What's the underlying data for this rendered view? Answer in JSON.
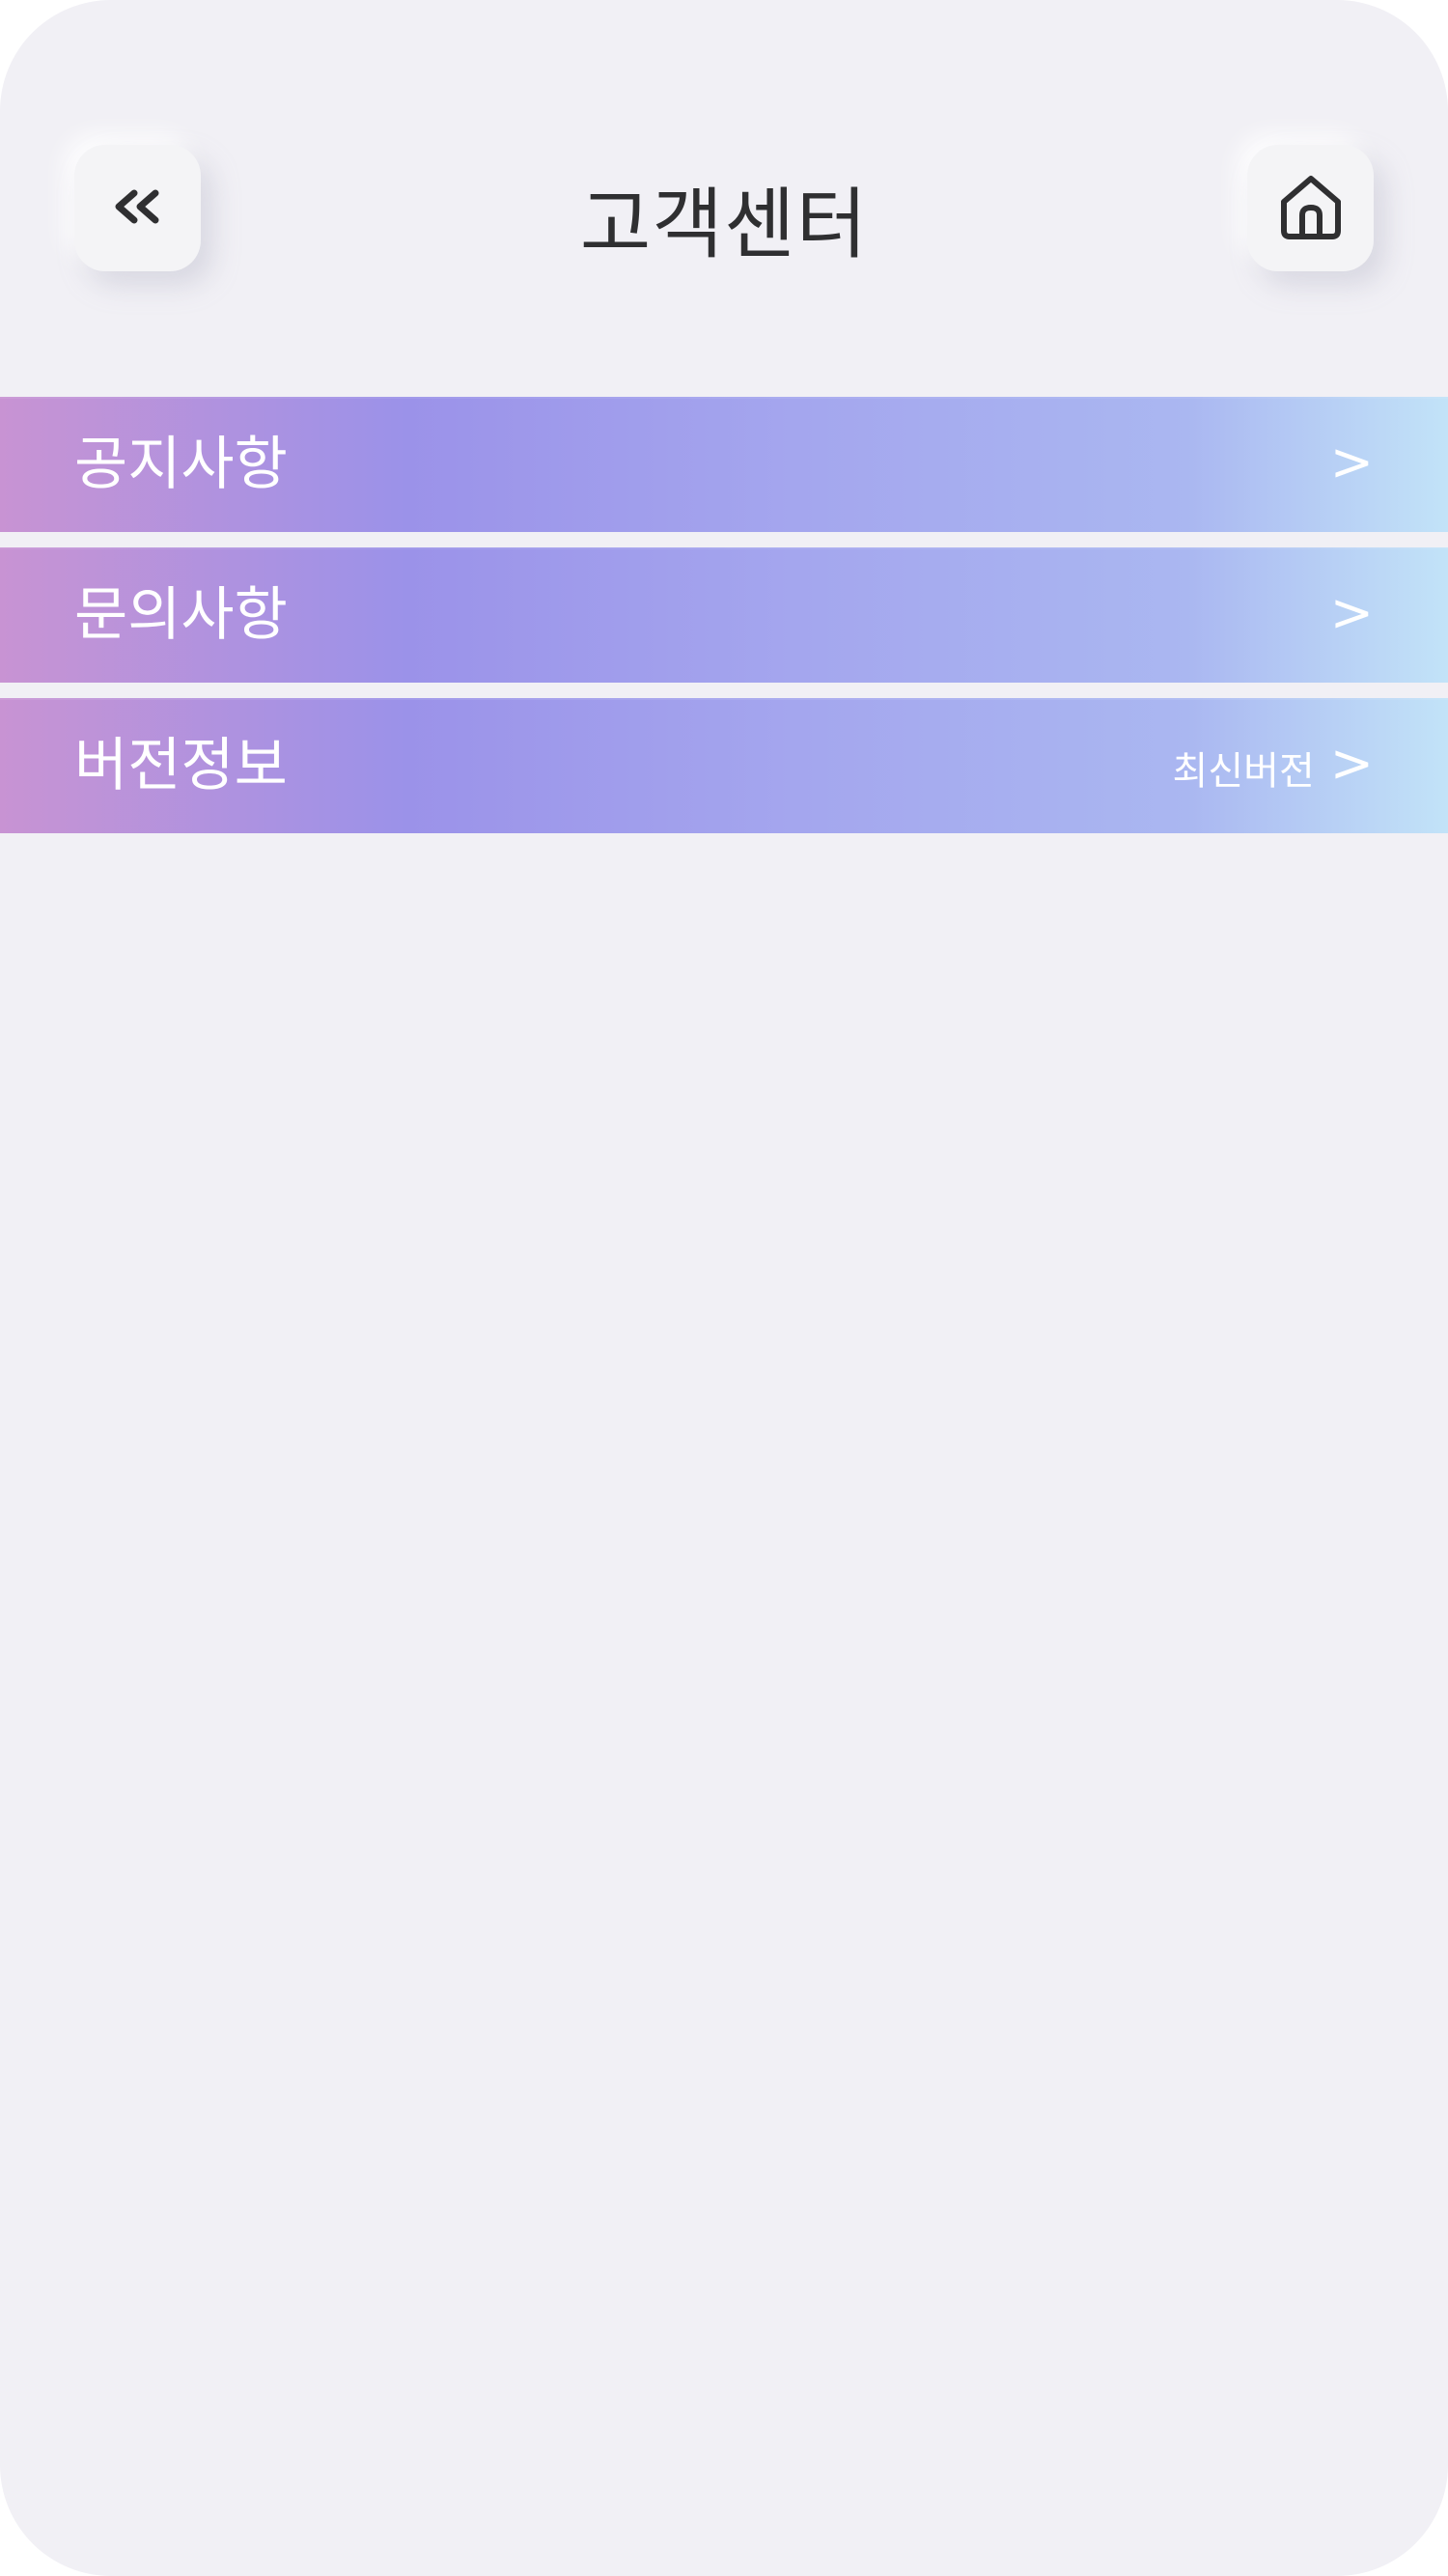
{
  "header": {
    "title": "고객센터",
    "back_icon": "double-chevron-left-icon",
    "home_icon": "home-icon"
  },
  "menu": {
    "items": [
      {
        "label": "공지사항",
        "sub": "",
        "chevron": ">"
      },
      {
        "label": "문의사항",
        "sub": "",
        "chevron": ">"
      },
      {
        "label": "버전정보",
        "sub": "최신버전",
        "chevron": ">"
      }
    ]
  },
  "colors": {
    "background": "#f1f0f5",
    "gradient_start": "#c893d3",
    "gradient_mid": "#9b92e9",
    "gradient_end": "#c2e3f8",
    "title_text": "#2f2f31",
    "menu_text": "#ffffff"
  }
}
